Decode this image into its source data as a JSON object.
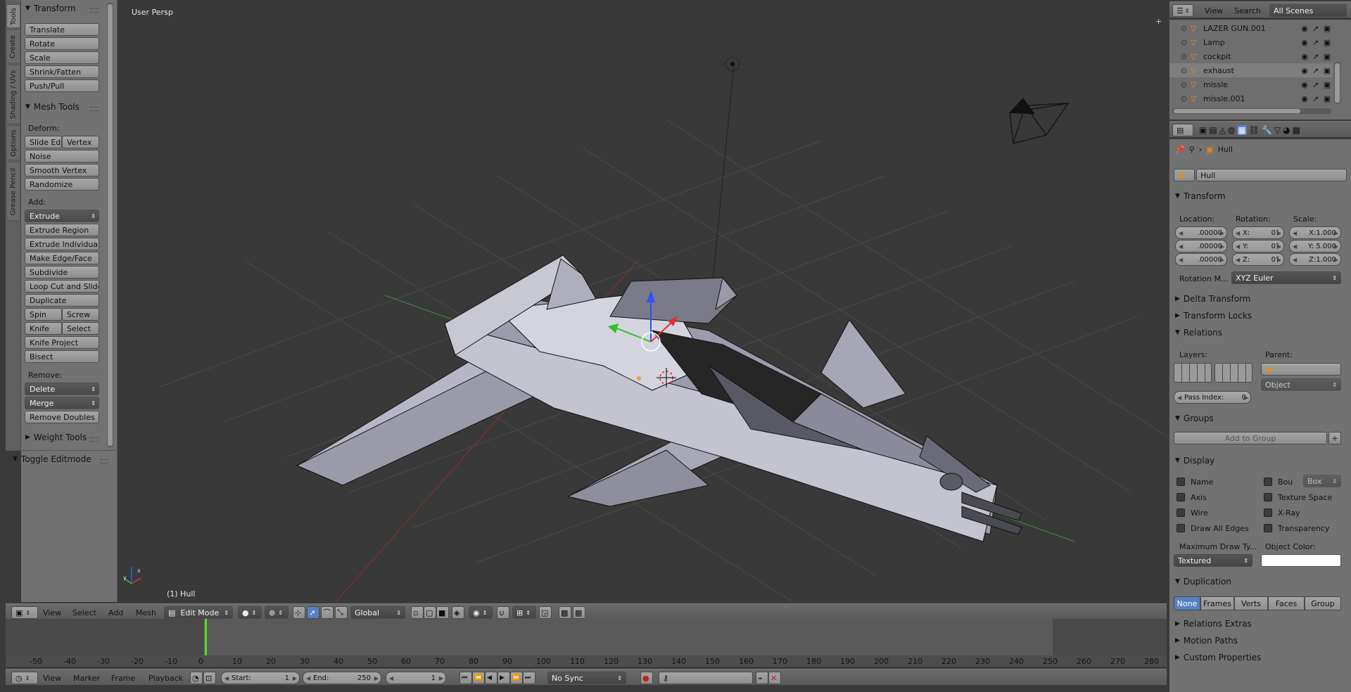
{
  "shelf_tabs": [
    "Tools",
    "Create",
    "Shading / UVs",
    "Options",
    "Grease Pencil"
  ],
  "transform_panel": {
    "title": "Transform",
    "buttons": [
      "Translate",
      "Rotate",
      "Scale",
      "Shrink/Fatten",
      "Push/Pull"
    ]
  },
  "mesh_tools": {
    "title": "Mesh Tools",
    "deform_label": "Deform:",
    "slide_edge": "Slide Ed",
    "vertex": "Vertex",
    "noise": "Noise",
    "smooth_vertex": "Smooth Vertex",
    "randomize": "Randomize",
    "add_label": "Add:",
    "extrude": "Extrude",
    "extrude_region": "Extrude Region",
    "extrude_individual": "Extrude Individual",
    "make_edge_face": "Make Edge/Face",
    "subdivide": "Subdivide",
    "loop_cut": "Loop Cut and Slide",
    "duplicate": "Duplicate",
    "spin": "Spin",
    "screw": "Screw",
    "knife": "Knife",
    "select": "Select",
    "knife_project": "Knife Project",
    "bisect": "Bisect",
    "remove_label": "Remove:",
    "delete": "Delete",
    "merge": "Merge",
    "remove_doubles": "Remove Doubles"
  },
  "weight_tools": "Weight Tools",
  "toggle_editmode": "Toggle Editmode",
  "viewport": {
    "title": "User Persp",
    "object_label": "(1) Hull"
  },
  "view3d_header": {
    "view": "View",
    "select": "Select",
    "add": "Add",
    "mesh": "Mesh",
    "mode": "Edit Mode",
    "orientation": "Global"
  },
  "timeline": {
    "ticks": [
      "-50",
      "-40",
      "-30",
      "-20",
      "-10",
      "0",
      "10",
      "20",
      "30",
      "40",
      "50",
      "60",
      "70",
      "80",
      "90",
      "100",
      "110",
      "120",
      "130",
      "140",
      "150",
      "160",
      "170",
      "180",
      "190",
      "200",
      "210",
      "220",
      "230",
      "240",
      "250",
      "260",
      "270",
      "280"
    ],
    "view": "View",
    "marker": "Marker",
    "frame": "Frame",
    "playback": "Playback",
    "start_label": "Start:",
    "start": "1",
    "end_label": "End:",
    "end": "250",
    "current": "1",
    "sync": "No Sync"
  },
  "outliner": {
    "view": "View",
    "search": "Search",
    "scenes": "All Scenes",
    "items": [
      {
        "name": "LAZER GUN.001",
        "selected": false
      },
      {
        "name": "Lamp",
        "selected": false
      },
      {
        "name": "cockpit",
        "selected": false
      },
      {
        "name": "exhaust",
        "selected": true
      },
      {
        "name": "missle",
        "selected": false
      },
      {
        "name": "missle.001",
        "selected": false
      }
    ]
  },
  "properties": {
    "breadcrumb": "Hull",
    "object_name": "Hull",
    "transform_title": "Transform",
    "location_label": "Location:",
    "rotation_label": "Rotation:",
    "scale_label": "Scale:",
    "location": [
      ".00000",
      ".00000",
      ".00000"
    ],
    "rotation": [
      {
        "axis": "X:",
        "value": "0°"
      },
      {
        "axis": "Y:",
        "value": "0°"
      },
      {
        "axis": "Z:",
        "value": "0°"
      }
    ],
    "scale": [
      "X:1.000",
      "Y: 5.000",
      "Z:1.000"
    ],
    "rotation_mode_label": "Rotation M...",
    "rotation_mode": "XYZ Euler",
    "delta_transform": "Delta Transform",
    "transform_locks": "Transform Locks",
    "relations": "Relations",
    "layers_label": "Layers:",
    "parent_label": "Parent:",
    "parent_type": "Object",
    "pass_index_label": "Pass Index:",
    "pass_index": "0",
    "groups": "Groups",
    "add_to_group": "Add to Group",
    "display": "Display",
    "display_left": [
      "Name",
      "Axis",
      "Wire",
      "Draw All Edges"
    ],
    "display_right": [
      "Bou",
      "Texture Space",
      "X-Ray",
      "Transparency"
    ],
    "bounds_type": "Box",
    "max_draw_label": "Maximum Draw Ty...",
    "max_draw": "Textured",
    "object_color_label": "Object Color:",
    "duplication": "Duplication",
    "dup_options": [
      "None",
      "Frames",
      "Verts",
      "Faces",
      "Group"
    ],
    "relations_extras": "Relations Extras",
    "motion_paths": "Motion Paths",
    "custom_properties": "Custom Properties"
  },
  "colors": {
    "accent": "#5680c2",
    "bg_dark": "#393939",
    "panel": "#727272",
    "timeline_cursor": "#52e01a"
  }
}
